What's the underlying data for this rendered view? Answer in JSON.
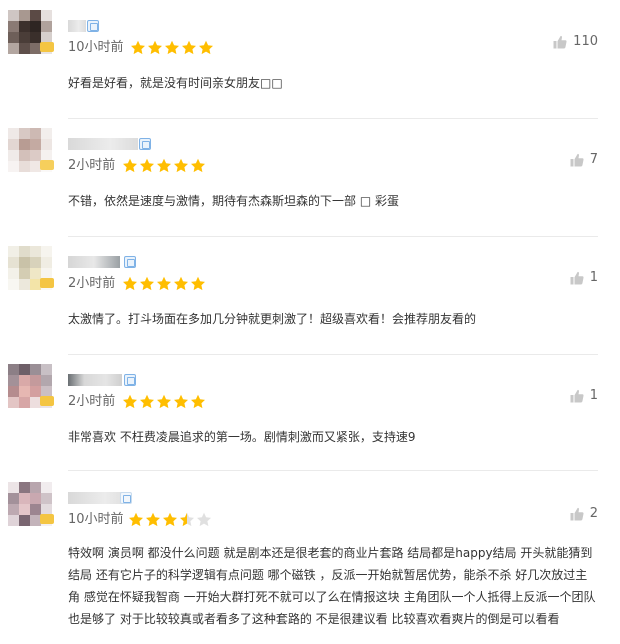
{
  "colors": {
    "star_on": "#ffbe00",
    "star_off": "#e0e0e0",
    "thumb": "#c8c8c8",
    "text": "#333333",
    "meta": "#666666"
  },
  "icons": {
    "star": "star-icon",
    "like": "thumbs-up-icon",
    "level": "user-level-icon"
  },
  "comments": [
    {
      "time": "10小时前",
      "rating": 5,
      "likes": "110",
      "text": "好看是好看，就是没有时间亲女朋友□□"
    },
    {
      "time": "2小时前",
      "rating": 5,
      "likes": "7",
      "text": "不错，依然是速度与激情，期待有杰森斯坦森的下一部 □ 彩蛋"
    },
    {
      "time": "2小时前",
      "rating": 5,
      "likes": "1",
      "text": "太激情了。打斗场面在多加几分钟就更刺激了！超级喜欢看！会推荐朋友看的"
    },
    {
      "time": "2小时前",
      "rating": 5,
      "likes": "1",
      "text": "非常喜欢 不枉费凌晨追求的第一场。剧情刺激而又紧张，支持速9"
    },
    {
      "time": "10小时前",
      "rating": 3.5,
      "likes": "2",
      "text": "特效啊 演员啊 都没什么问题 就是剧本还是很老套的商业片套路 结局都是happy结局 开头就能猜到结局 还有它片子的科学逻辑有点问题 哪个磁铁 ，反派一开始就暂居优势，能杀不杀 好几次放过主角 感觉在怀疑我智商 一开始大群打死不就可以了么在情报这块 主角团队一个人抵得上反派一个团队也是够了 对于比较较真或者看多了这种套路的 不是很建议看 比较喜欢看爽片的倒是可以看看"
    }
  ]
}
